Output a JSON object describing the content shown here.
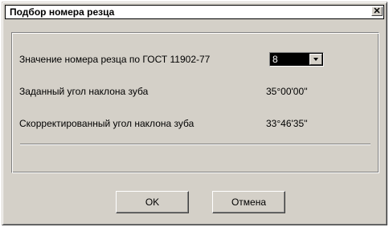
{
  "window": {
    "title": "Подбор номера резца",
    "close_label": "✕"
  },
  "form": {
    "rows": [
      {
        "label": "Значение номера резца по ГОСТ 11902-77",
        "value": "8"
      },
      {
        "label": "Заданный угол наклона зуба",
        "value": "35°00'00''"
      },
      {
        "label": "Скорректированный угол наклона зуба",
        "value": "33°46'35''"
      }
    ]
  },
  "buttons": {
    "ok_label": "OK",
    "cancel_label": "Отмена"
  },
  "colors": {
    "face": "#d4d0c8",
    "highlight": "#ffffff",
    "shadow": "#808080",
    "dark_shadow": "#404040"
  }
}
